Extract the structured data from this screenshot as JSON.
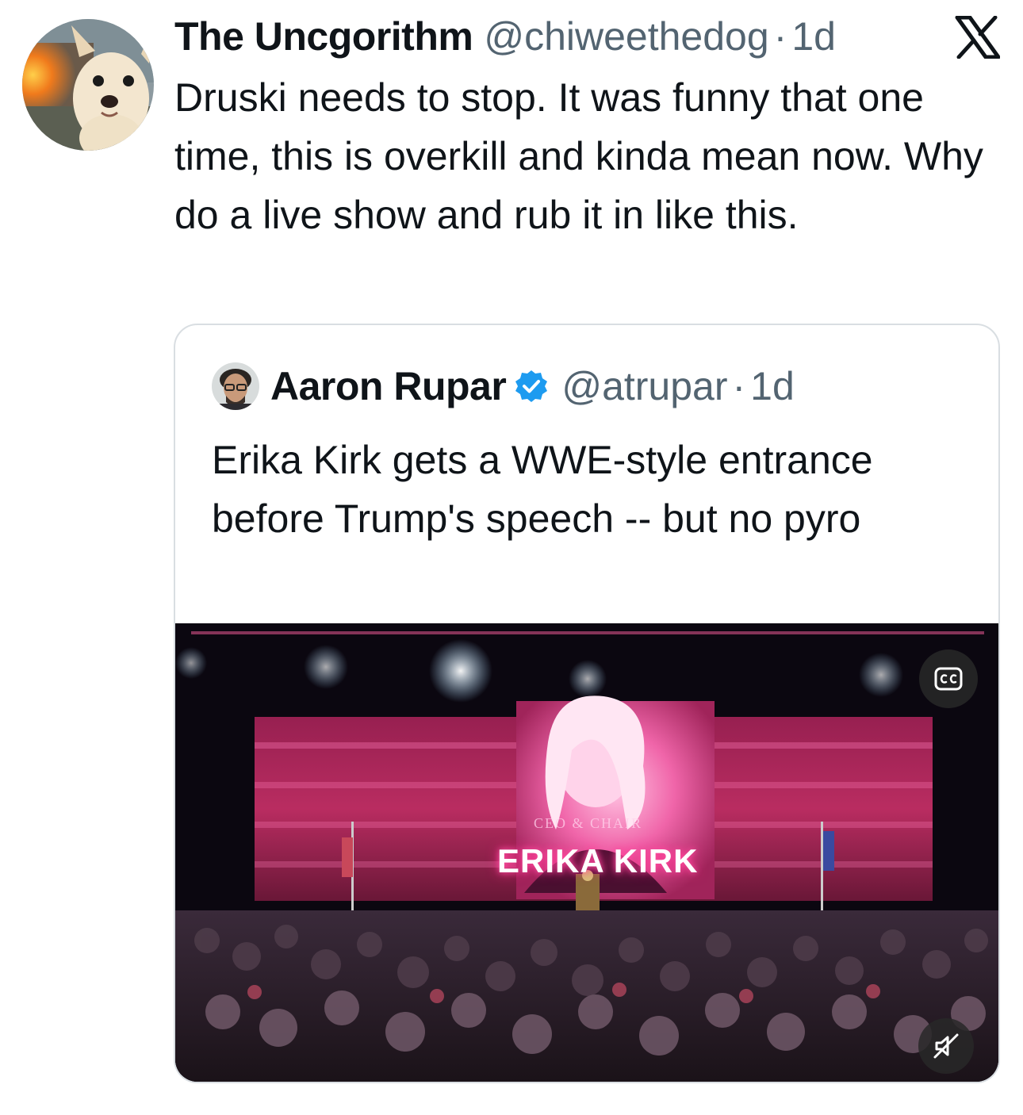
{
  "tweet": {
    "display_name": "The Uncgorithm",
    "handle": "@chiweethedog",
    "separator": "·",
    "time": "1d",
    "platform_icon": "x-logo-icon",
    "text": "Druski needs to stop. It was funny that one time, this is overkill and kinda mean now. Why do a live show and rub it in like this."
  },
  "quoted_tweet": {
    "display_name": "Aaron Rupar",
    "verified": true,
    "handle": "@atrupar",
    "separator": "·",
    "time": "1d",
    "text": "Erika Kirk gets a WWE-style entrance before Trump's speech -- but no pyro",
    "media": {
      "type": "video",
      "stage_screen_name": "ERIKA KIRK",
      "stage_screen_subtitle": "CEO & CHAIR",
      "captions_icon": "closed-captions-icon",
      "mute_icon": "muted-speaker-icon"
    }
  },
  "colors": {
    "text_primary": "#0f1419",
    "text_secondary": "#536471",
    "verified_blue": "#1d9bf0",
    "border": "#d9dee2",
    "stage_pink": "#ff4fa3"
  }
}
